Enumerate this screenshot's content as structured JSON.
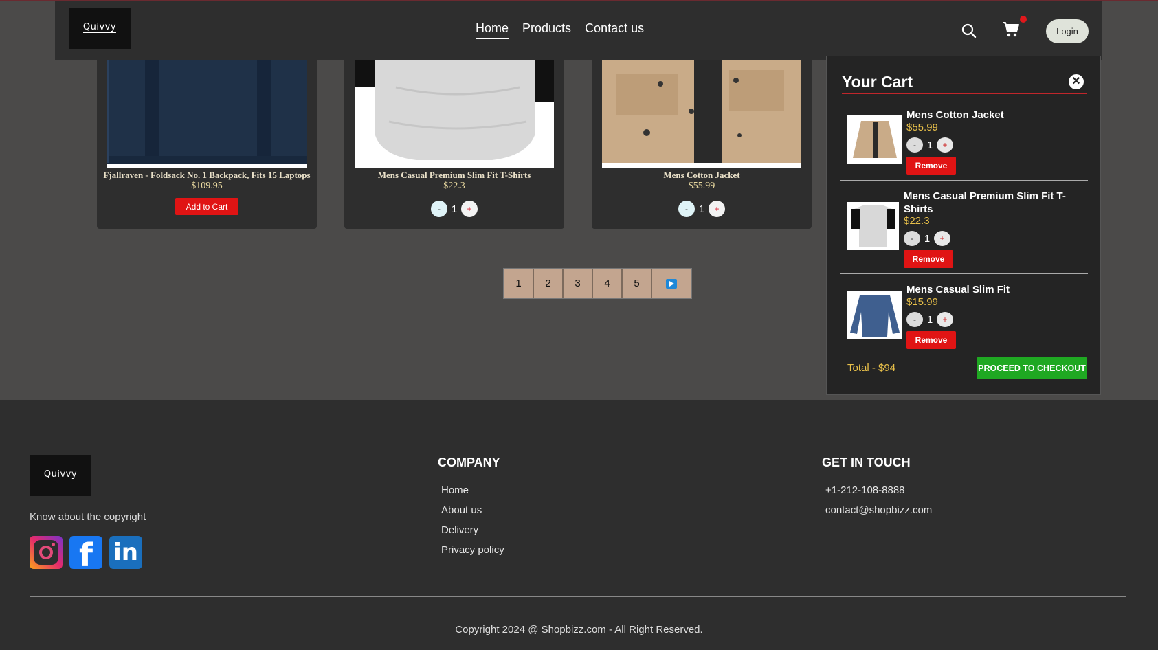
{
  "brand": {
    "logo_text": "Quivvy"
  },
  "nav": {
    "links": [
      "Home",
      "Products",
      "Contact us"
    ],
    "active": "Home",
    "login_label": "Login"
  },
  "products": [
    {
      "name": "Fjallraven - Foldsack No. 1 Backpack, Fits 15 Laptops",
      "price": "$109.95",
      "action": "Add to Cart"
    },
    {
      "name": "Mens Casual Premium Slim Fit T-Shirts",
      "price": "$22.3",
      "qty": "1"
    },
    {
      "name": "Mens Cotton Jacket",
      "price": "$55.99",
      "qty": "1"
    }
  ],
  "qty_controls": {
    "minus": "-",
    "plus": "+"
  },
  "pagination": {
    "pages": [
      "1",
      "2",
      "3",
      "4",
      "5"
    ]
  },
  "cart": {
    "title": "Your Cart",
    "items": [
      {
        "name": "Mens Cotton Jacket",
        "price": "$55.99",
        "qty": "1",
        "remove": "Remove"
      },
      {
        "name": "Mens Casual Premium Slim Fit T-Shirts",
        "price": "$22.3",
        "qty": "1",
        "remove": "Remove"
      },
      {
        "name": "Mens Casual Slim Fit",
        "price": "$15.99",
        "qty": "1",
        "remove": "Remove"
      }
    ],
    "total": "Total - $94",
    "checkout": "PROCEED TO CHECKOUT"
  },
  "footer": {
    "logo_text": "Quivvy",
    "copyright_link": "Know about the copyright",
    "company_title": "COMPANY",
    "company_links": [
      "Home",
      "About us",
      "Delivery",
      "Privacy policy"
    ],
    "contact_title": "GET IN TOUCH",
    "phone": "+1-212-108-8888",
    "email": "contact@shopbizz.com",
    "copyright": "Copyright 2024 @ Shopbizz.com - All Right Reserved.",
    "social": [
      "instagram-icon",
      "facebook-icon",
      "linkedin-icon"
    ]
  },
  "colors": {
    "accent_red": "#e01414",
    "checkout_green": "#1fa822",
    "price_gold": "#e8c04a"
  }
}
